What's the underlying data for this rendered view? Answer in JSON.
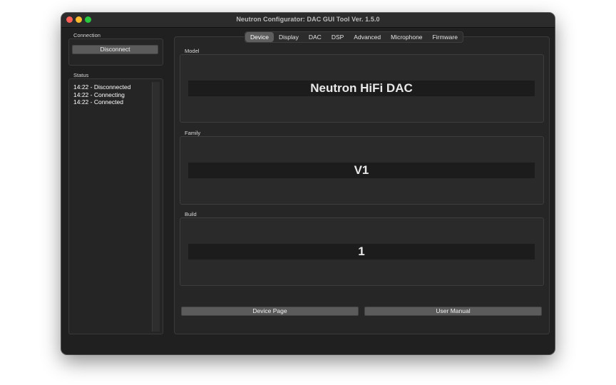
{
  "window": {
    "title": "Neutron Configurator: DAC GUI Tool Ver. 1.5.0"
  },
  "connection": {
    "label": "Connection",
    "button_label": "Disconnect"
  },
  "status": {
    "label": "Status",
    "lines": [
      "14:22 - Disconnected",
      "14:22 - Connecting",
      "14:22 - Connected"
    ]
  },
  "tabs": [
    {
      "label": "Device",
      "active": true
    },
    {
      "label": "Display",
      "active": false
    },
    {
      "label": "DAC",
      "active": false
    },
    {
      "label": "DSP",
      "active": false
    },
    {
      "label": "Advanced",
      "active": false
    },
    {
      "label": "Microphone",
      "active": false
    },
    {
      "label": "Firmware",
      "active": false
    }
  ],
  "device": {
    "model_label": "Model",
    "model_value": "Neutron HiFi DAC",
    "family_label": "Family",
    "family_value": "V1",
    "build_label": "Build",
    "build_value": "1",
    "device_page_button": "Device Page",
    "user_manual_button": "User Manual"
  },
  "colors": {
    "window_bg": "#202020",
    "titlebar_bg": "#2c2c2c",
    "close": "#ff5f57",
    "minimize": "#febc2e",
    "maximize": "#28c840",
    "button_bg": "#5b5b5b",
    "active_tab_bg": "#5e5e5e"
  }
}
